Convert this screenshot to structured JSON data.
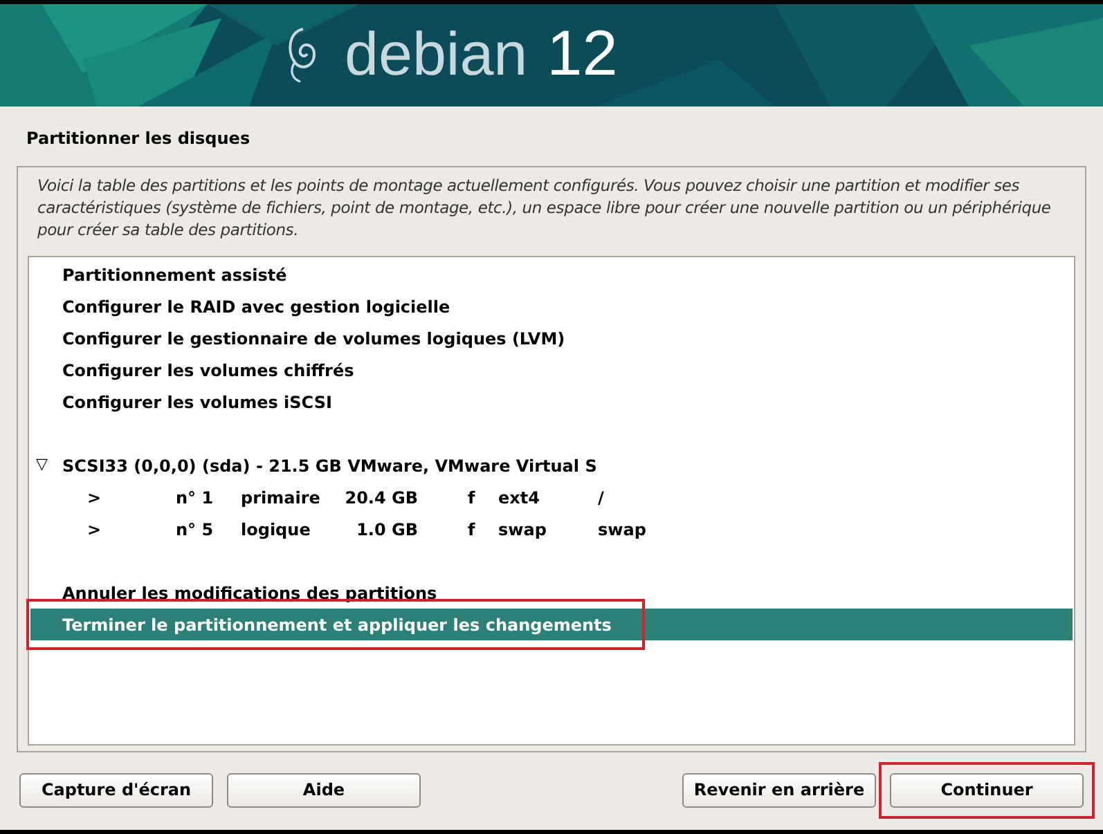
{
  "banner": {
    "logo_word": "debian",
    "logo_version": "12"
  },
  "title": "Partitionner les disques",
  "description": "Voici la table des partitions et les points de montage actuellement configurés. Vous pouvez choisir une partition et modifier ses caractéristiques (système de fichiers, point de montage, etc.), un espace libre pour créer une nouvelle partition ou un périphérique pour créer sa table des partitions.",
  "menu": {
    "groups": [
      {
        "items": [
          {
            "kind": "action",
            "label": "Partitionnement assisté",
            "selected": false,
            "highlighted": false
          },
          {
            "kind": "action",
            "label": "Configurer le RAID avec gestion logicielle",
            "selected": false,
            "highlighted": false
          },
          {
            "kind": "action",
            "label": "Configurer le gestionnaire de volumes logiques (LVM)",
            "selected": false,
            "highlighted": false
          },
          {
            "kind": "action",
            "label": "Configurer les volumes chiffrés",
            "selected": false,
            "highlighted": false
          },
          {
            "kind": "action",
            "label": "Configurer les volumes iSCSI",
            "selected": false,
            "highlighted": false
          }
        ]
      },
      {
        "items": [
          {
            "kind": "disk",
            "toggle": "▽",
            "label": "SCSI33 (0,0,0) (sda) - 21.5 GB VMware, VMware Virtual S",
            "selected": false,
            "highlighted": false,
            "expanded": true,
            "children": [
              {
                "marker": ">",
                "number": "n° 1",
                "type": "primaire",
                "size": "20.4 GB",
                "flag": "f",
                "filesystem": "ext4",
                "mount": "/",
                "selected": false
              },
              {
                "marker": ">",
                "number": "n° 5",
                "type": "logique",
                "size": "1.0 GB",
                "flag": "f",
                "filesystem": "swap",
                "mount": "swap",
                "selected": false
              }
            ]
          }
        ]
      },
      {
        "items": [
          {
            "kind": "action",
            "label": "Annuler les modifications des partitions",
            "selected": false,
            "highlighted": false
          },
          {
            "kind": "action",
            "label": "Terminer le partitionnement et appliquer les changements",
            "selected": true,
            "highlighted": true
          }
        ]
      }
    ]
  },
  "buttons_left": [
    {
      "label": "Capture d'écran",
      "highlighted": false
    },
    {
      "label": "Aide",
      "highlighted": false
    }
  ],
  "buttons_right": [
    {
      "label": "Revenir en arrière",
      "highlighted": false
    },
    {
      "label": "Continuer",
      "highlighted": true
    }
  ]
}
